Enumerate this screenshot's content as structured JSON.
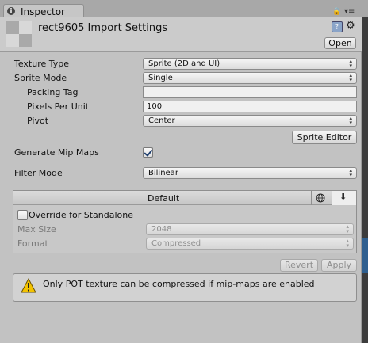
{
  "window": {
    "tab_label": "Inspector",
    "tab_icon": "info-icon"
  },
  "header": {
    "title": "rect9605 Import Settings",
    "open_label": "Open",
    "icons": [
      "help-icon",
      "gear-icon",
      "lock-icon",
      "menu-icon"
    ]
  },
  "fields": {
    "texture_type": {
      "label": "Texture Type",
      "value": "Sprite (2D and UI)"
    },
    "sprite_mode": {
      "label": "Sprite Mode",
      "value": "Single"
    },
    "packing_tag": {
      "label": "Packing Tag",
      "value": ""
    },
    "pixels_per_unit": {
      "label": "Pixels Per Unit",
      "value": "100"
    },
    "pivot": {
      "label": "Pivot",
      "value": "Center"
    },
    "sprite_editor_label": "Sprite Editor",
    "generate_mip_maps": {
      "label": "Generate Mip Maps",
      "checked": true
    },
    "filter_mode": {
      "label": "Filter Mode",
      "value": "Bilinear"
    }
  },
  "platform": {
    "tab_label": "Default",
    "tab_icons": [
      "globe-icon",
      "download-icon"
    ],
    "override_label": "Override for Standalone",
    "override_checked": false,
    "max_size": {
      "label": "Max Size",
      "value": "2048"
    },
    "format": {
      "label": "Format",
      "value": "Compressed"
    }
  },
  "actions": {
    "revert_label": "Revert",
    "apply_label": "Apply"
  },
  "warning": {
    "icon": "warning-icon",
    "text": "Only POT texture can be compressed if mip-maps are enabled"
  },
  "colors": {
    "panel_bg": "#c2c2c2",
    "tab_strip_bg": "#a8a8a8",
    "check_color": "#1f3f6f",
    "warning_yellow": "#f2c200"
  }
}
